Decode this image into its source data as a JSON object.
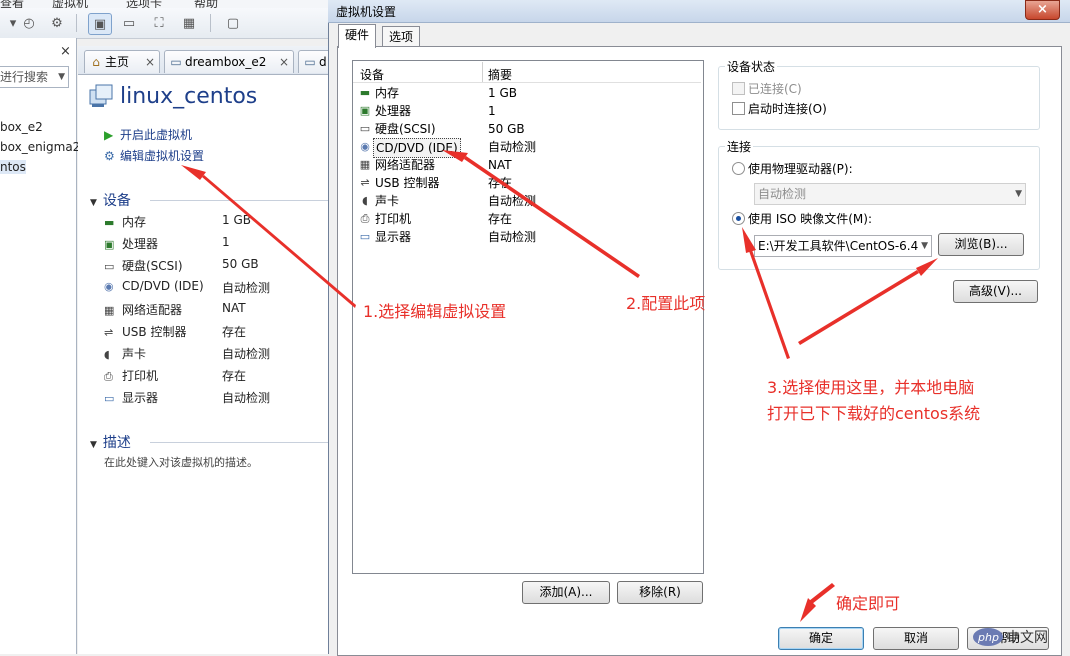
{
  "background_app": {
    "menu_fragments": [
      "查看",
      "虚拟机",
      "选项卡",
      "帮助"
    ],
    "library": {
      "close_label": "×",
      "search_placeholder": "进行搜索",
      "items": [
        "box_e2",
        "box_enigma2",
        "ntos"
      ]
    },
    "tabs": [
      {
        "label": "主页",
        "icon": "home-icon"
      },
      {
        "label": "dreambox_e2",
        "icon": "vm-tab-icon"
      },
      {
        "label": "d",
        "icon": "vm-tab-icon"
      }
    ],
    "vm_title": "linux_centos",
    "actions": [
      {
        "label": "开启此虚拟机",
        "icon": "play-icon"
      },
      {
        "label": "编辑虚拟机设置",
        "icon": "settings-icon"
      }
    ],
    "devices_section": "设备",
    "devices": [
      {
        "name": "内存",
        "value": "1 GB",
        "icon": "memory-icon"
      },
      {
        "name": "处理器",
        "value": "1",
        "icon": "cpu-icon"
      },
      {
        "name": "硬盘(SCSI)",
        "value": "50 GB",
        "icon": "disk-icon"
      },
      {
        "name": "CD/DVD (IDE)",
        "value": "自动检测",
        "icon": "cdrom-icon"
      },
      {
        "name": "网络适配器",
        "value": "NAT",
        "icon": "network-icon"
      },
      {
        "name": "USB 控制器",
        "value": "存在",
        "icon": "usb-icon"
      },
      {
        "name": "声卡",
        "value": "自动检测",
        "icon": "sound-icon"
      },
      {
        "name": "打印机",
        "value": "存在",
        "icon": "printer-icon"
      },
      {
        "name": "显示器",
        "value": "自动检测",
        "icon": "display-icon"
      }
    ],
    "description_section": "描述",
    "description_placeholder": "在此处键入对该虚拟机的描述。"
  },
  "dialog": {
    "title": "虚拟机设置",
    "close_label": "×",
    "tabs": [
      "硬件",
      "选项"
    ],
    "list_headers": {
      "device": "设备",
      "summary": "摘要"
    },
    "rows": [
      {
        "name": "内存",
        "value": "1 GB",
        "icon": "memory-icon"
      },
      {
        "name": "处理器",
        "value": "1",
        "icon": "cpu-icon"
      },
      {
        "name": "硬盘(SCSI)",
        "value": "50 GB",
        "icon": "disk-icon"
      },
      {
        "name": "CD/DVD (IDE)",
        "value": "自动检测",
        "icon": "cdrom-icon",
        "selected": true
      },
      {
        "name": "网络适配器",
        "value": "NAT",
        "icon": "network-icon"
      },
      {
        "name": "USB 控制器",
        "value": "存在",
        "icon": "usb-icon"
      },
      {
        "name": "声卡",
        "value": "自动检测",
        "icon": "sound-icon"
      },
      {
        "name": "打印机",
        "value": "存在",
        "icon": "printer-icon"
      },
      {
        "name": "显示器",
        "value": "自动检测",
        "icon": "display-icon"
      }
    ],
    "add_button": "添加(A)...",
    "remove_button": "移除(R)",
    "device_status": {
      "title": "设备状态",
      "connected": "已连接(C)",
      "connect_at_power_on": "启动时连接(O)"
    },
    "connection": {
      "title": "连接",
      "physical_drive": "使用物理驱动器(P):",
      "physical_drive_value": "自动检测",
      "iso_image": "使用 ISO 映像文件(M):",
      "iso_path": "E:\\开发工具软件\\CentOS-6.4",
      "browse_button": "浏览(B)..."
    },
    "advanced_button": "高级(V)...",
    "ok_button": "确定",
    "cancel_button": "取消",
    "help_button": "帮助"
  },
  "annotations": {
    "step1": "1.选择编辑虚拟设置",
    "step2": "2.配置此项",
    "step3_line1": "3.选择使用这里，并本地电脑",
    "step3_line2": "打开已下下载好的centos系统",
    "step4": "确定即可",
    "color": "#e8302a"
  },
  "watermark": "php中文网"
}
